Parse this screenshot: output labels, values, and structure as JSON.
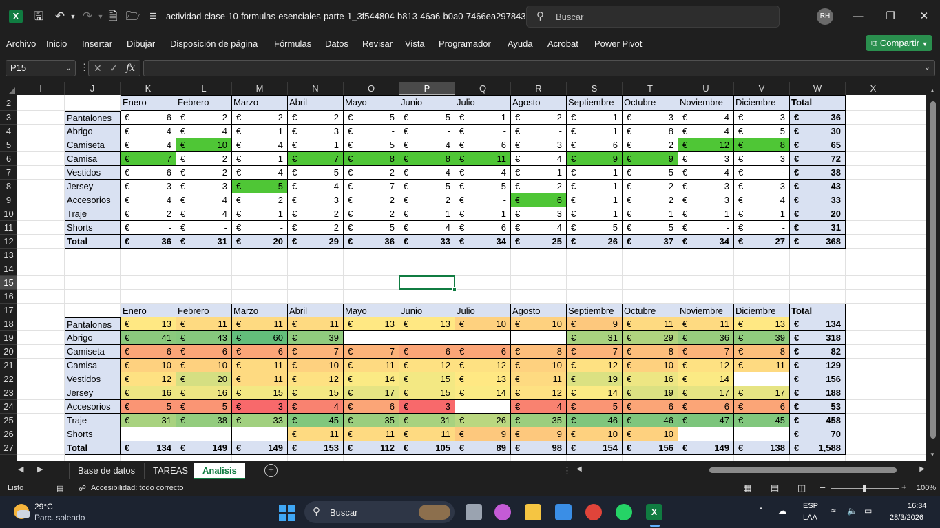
{
  "titlebar": {
    "app_logo": "X",
    "title": "actividad-clase-10-formulas-esenciales-parte-1_3f544804-b813-46a6-b0a0-7466ea297843  -...",
    "search_placeholder": "Buscar",
    "user_initials": "RH",
    "icons": [
      "save-icon",
      "undo-icon",
      "redo-icon",
      "new-file-icon",
      "open-folder-icon",
      "customize-icon"
    ]
  },
  "menu": {
    "items": [
      "Archivo",
      "Inicio",
      "Insertar",
      "Dibujar",
      "Disposición de página",
      "Fórmulas",
      "Datos",
      "Revisar",
      "Vista",
      "Programador",
      "Ayuda",
      "Acrobat",
      "Power Pivot"
    ],
    "share_label": "Compartir"
  },
  "formula_bar": {
    "name_box": "P15",
    "fx_label": "fx",
    "value": ""
  },
  "grid": {
    "columns": [
      "I",
      "J",
      "K",
      "L",
      "M",
      "N",
      "O",
      "P",
      "Q",
      "R",
      "S",
      "T",
      "U",
      "V",
      "W",
      "X"
    ],
    "rows": [
      "2",
      "3",
      "4",
      "5",
      "6",
      "7",
      "8",
      "9",
      "10",
      "11",
      "12",
      "13",
      "14",
      "15",
      "16",
      "17",
      "18",
      "19",
      "20",
      "21",
      "22",
      "23",
      "24",
      "25",
      "26",
      "27"
    ],
    "selected_cell": "P15",
    "currency": "€",
    "table1": {
      "header": [
        "Enero",
        "Febrero",
        "Marzo",
        "Abril",
        "Mayo",
        "Junio",
        "Julio",
        "Agosto",
        "Septiembre",
        "Octubre",
        "Noviembre",
        "Diciembre",
        "Total"
      ],
      "rows": [
        {
          "label": "Pantalones",
          "values": [
            "6",
            "2",
            "2",
            "2",
            "5",
            "5",
            "1",
            "2",
            "1",
            "3",
            "4",
            "3",
            "36"
          ]
        },
        {
          "label": "Abrigo",
          "values": [
            "4",
            "4",
            "1",
            "3",
            "-",
            "-",
            "-",
            "-",
            "1",
            "8",
            "4",
            "5",
            "30"
          ]
        },
        {
          "label": "Camiseta",
          "values": [
            "4",
            "10",
            "4",
            "1",
            "5",
            "4",
            "6",
            "3",
            "6",
            "2",
            "12",
            "8",
            "65"
          ]
        },
        {
          "label": "Camisa",
          "values": [
            "7",
            "2",
            "1",
            "7",
            "8",
            "8",
            "11",
            "4",
            "9",
            "9",
            "3",
            "3",
            "72"
          ]
        },
        {
          "label": "Vestidos",
          "values": [
            "6",
            "2",
            "4",
            "5",
            "2",
            "4",
            "4",
            "1",
            "1",
            "5",
            "4",
            "-",
            "38"
          ]
        },
        {
          "label": "Jersey",
          "values": [
            "3",
            "3",
            "5",
            "4",
            "7",
            "5",
            "5",
            "2",
            "1",
            "2",
            "3",
            "3",
            "43"
          ]
        },
        {
          "label": "Accesorios",
          "values": [
            "4",
            "4",
            "2",
            "3",
            "2",
            "2",
            "-",
            "6",
            "1",
            "2",
            "3",
            "4",
            "33"
          ]
        },
        {
          "label": "Traje",
          "values": [
            "2",
            "4",
            "1",
            "2",
            "2",
            "1",
            "1",
            "3",
            "1",
            "1",
            "1",
            "1",
            "20"
          ]
        },
        {
          "label": "Shorts",
          "values": [
            "-",
            "-",
            "-",
            "2",
            "5",
            "4",
            "6",
            "4",
            "5",
            "5",
            "-",
            "-",
            "31"
          ]
        },
        {
          "label": "Total",
          "values": [
            "36",
            "31",
            "20",
            "29",
            "36",
            "33",
            "34",
            "25",
            "26",
            "37",
            "34",
            "27",
            "368"
          ]
        }
      ],
      "highlight_color": "#4fc636",
      "highlights": [
        [
          2,
          1
        ],
        [
          2,
          10
        ],
        [
          2,
          11
        ],
        [
          3,
          0
        ],
        [
          3,
          3
        ],
        [
          3,
          4
        ],
        [
          3,
          5
        ],
        [
          3,
          6
        ],
        [
          3,
          8
        ],
        [
          3,
          9
        ],
        [
          5,
          2
        ],
        [
          6,
          7
        ]
      ]
    },
    "table2": {
      "header": [
        "Enero",
        "Febrero",
        "Marzo",
        "Abril",
        "Mayo",
        "Junio",
        "Julio",
        "Agosto",
        "Septiembre",
        "Octubre",
        "Noviembre",
        "Diciembre",
        "Total"
      ],
      "rows": [
        {
          "label": "Pantalones",
          "values": [
            "13",
            "11",
            "11",
            "11",
            "13",
            "13",
            "10",
            "10",
            "9",
            "11",
            "11",
            "13",
            "134"
          ]
        },
        {
          "label": "Abrigo",
          "values": [
            "41",
            "43",
            "60",
            "39",
            "",
            "",
            "",
            "",
            "31",
            "29",
            "36",
            "39",
            "318"
          ]
        },
        {
          "label": "Camiseta",
          "values": [
            "6",
            "6",
            "6",
            "7",
            "7",
            "6",
            "6",
            "8",
            "7",
            "8",
            "7",
            "8",
            "82"
          ]
        },
        {
          "label": "Camisa",
          "values": [
            "10",
            "10",
            "11",
            "10",
            "11",
            "12",
            "12",
            "10",
            "12",
            "10",
            "12",
            "11",
            "129"
          ]
        },
        {
          "label": "Vestidos",
          "values": [
            "12",
            "20",
            "11",
            "12",
            "14",
            "15",
            "13",
            "11",
            "19",
            "16",
            "14",
            "",
            "156"
          ]
        },
        {
          "label": "Jersey",
          "values": [
            "16",
            "16",
            "15",
            "15",
            "17",
            "15",
            "14",
            "12",
            "14",
            "19",
            "17",
            "17",
            "188"
          ]
        },
        {
          "label": "Accesorios",
          "values": [
            "5",
            "5",
            "3",
            "4",
            "6",
            "3",
            "",
            "4",
            "5",
            "6",
            "6",
            "6",
            "53"
          ]
        },
        {
          "label": "Traje",
          "values": [
            "31",
            "38",
            "33",
            "45",
            "35",
            "31",
            "26",
            "35",
            "46",
            "46",
            "47",
            "45",
            "458"
          ]
        },
        {
          "label": "Shorts",
          "values": [
            "",
            "",
            "",
            "11",
            "11",
            "11",
            "9",
            "9",
            "10",
            "10",
            "",
            "",
            "70"
          ]
        },
        {
          "label": "Total",
          "values": [
            "134",
            "149",
            "149",
            "153",
            "112",
            "105",
            "89",
            "98",
            "154",
            "156",
            "149",
            "138",
            "1,588"
          ]
        }
      ],
      "scale_colors": {
        "low": "#f8696b",
        "mid": "#ffeb84",
        "high": "#63be7b"
      }
    },
    "header_fill": "#d9e1f2"
  },
  "sheets": {
    "tabs": [
      "Base de datos",
      "TAREAS",
      "Analisis"
    ],
    "active": "Analisis"
  },
  "status": {
    "ready": "Listo",
    "accessibility": "Accesibilidad: todo correcto",
    "zoom": "100%"
  },
  "taskbar": {
    "temp": "29°C",
    "weather": "Parc. soleado",
    "search": "Buscar",
    "lang": "ESP",
    "layout": "LAA",
    "time": "16:34",
    "date": "28/3/2026"
  }
}
